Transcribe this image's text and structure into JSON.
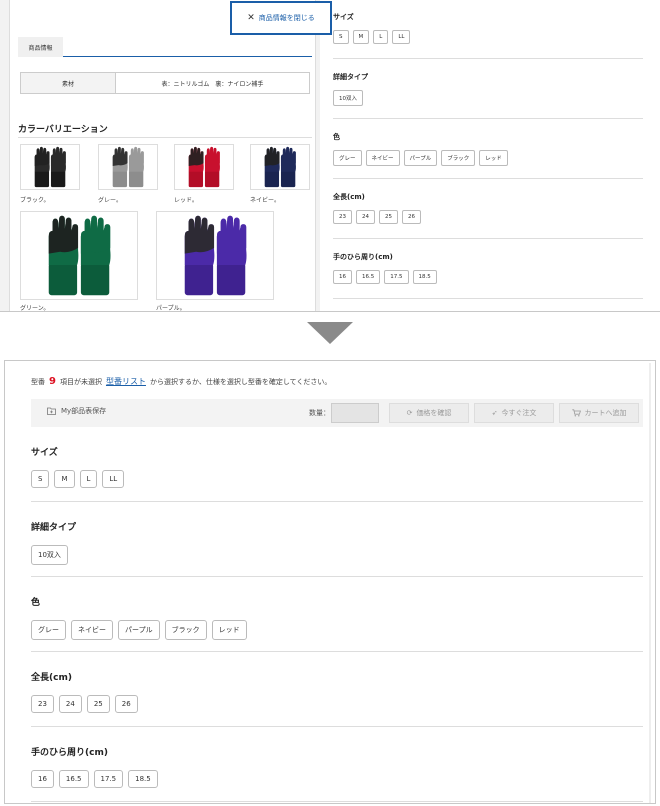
{
  "before": {
    "close_button": "商品情報を閉じる",
    "tab_label": "商品情報",
    "spec": {
      "key": "素材",
      "value": "表：ニトリルゴム　裏：ナイロン補手"
    },
    "color_variation_title": "カラーバリエーション",
    "thumbs": [
      {
        "label": "ブラック。",
        "palm": "#222222",
        "back": "#2a2a2a",
        "cuff": "#1a1a1a"
      },
      {
        "label": "グレー。",
        "palm": "#2a2a2a",
        "back": "#9a9a9a",
        "cuff": "#8d8d8d"
      },
      {
        "label": "レッド。",
        "palm": "#222222",
        "back": "#c8102e",
        "cuff": "#b30d27"
      },
      {
        "label": "ネイビー。",
        "palm": "#222222",
        "back": "#1f2a5a",
        "cuff": "#1a2450"
      },
      {
        "label": "グリーン。",
        "palm": "#1e1e1e",
        "back": "#0f6b45",
        "cuff": "#0c5c3b"
      },
      {
        "label": "パープル。",
        "palm": "#2a2a2a",
        "back": "#4b2aa8",
        "cuff": "#3f2290"
      }
    ],
    "options": [
      {
        "title": "サイズ",
        "chips": [
          "S",
          "M",
          "L",
          "LL"
        ]
      },
      {
        "title": "詳細タイプ",
        "chips": [
          "10双入"
        ]
      },
      {
        "title": "色",
        "chips": [
          "グレー",
          "ネイビー",
          "パープル",
          "ブラック",
          "レッド"
        ]
      },
      {
        "title": "全長(cm)",
        "chips": [
          "23",
          "24",
          "25",
          "26"
        ]
      },
      {
        "title": "手のひら周り(cm)",
        "chips": [
          "16",
          "16.5",
          "17.5",
          "18.5"
        ]
      }
    ]
  },
  "after": {
    "notice": {
      "prefix": "型番",
      "count": "9",
      "middle": "項目が未選択",
      "link": "型番リスト",
      "suffix": "から選択するか、仕様を選択し型番を確定してください。"
    },
    "toolbar": {
      "save": "My部品表保存",
      "qty_label": "数量：",
      "price_btn": "価格を確認",
      "order_btn": "今すぐ注文",
      "cart_btn": "カートへ追加"
    },
    "options": [
      {
        "title": "サイズ",
        "chips": [
          "S",
          "M",
          "L",
          "LL"
        ]
      },
      {
        "title": "詳細タイプ",
        "chips": [
          "10双入"
        ]
      },
      {
        "title": "色",
        "chips": [
          "グレー",
          "ネイビー",
          "パープル",
          "ブラック",
          "レッド"
        ]
      },
      {
        "title": "全長(cm)",
        "chips": [
          "23",
          "24",
          "25",
          "26"
        ]
      },
      {
        "title": "手のひら周り(cm)",
        "chips": [
          "16",
          "16.5",
          "17.5",
          "18.5"
        ]
      }
    ]
  }
}
